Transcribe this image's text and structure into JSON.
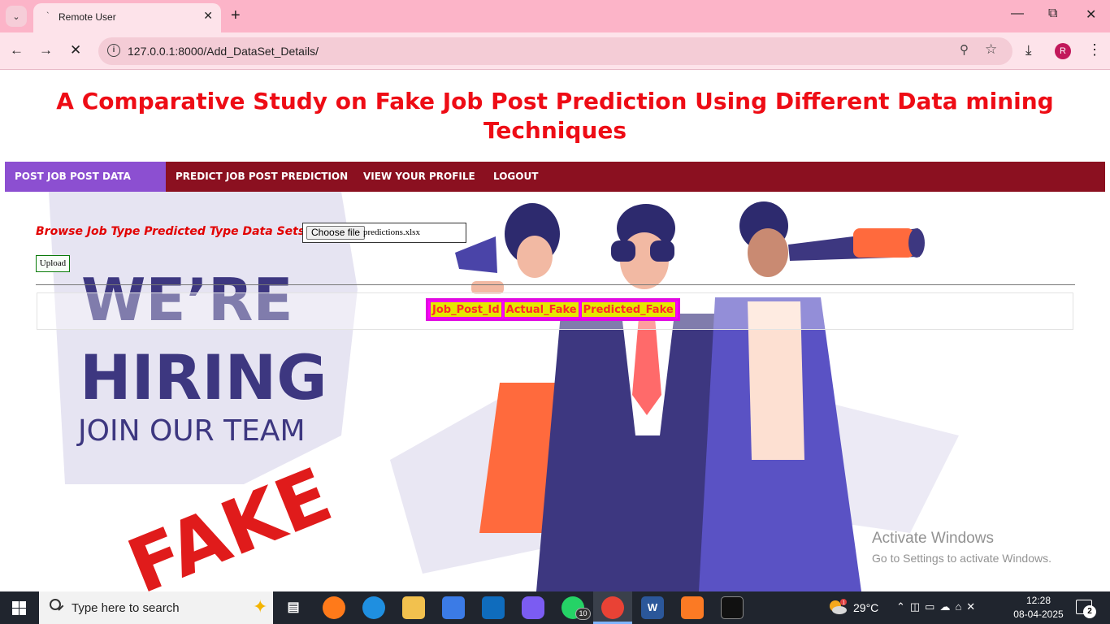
{
  "browser": {
    "tab_title": "Remote User",
    "tab_spinner": "`",
    "url": "127.0.0.1:8000/Add_DataSet_Details/",
    "profile_initial": "R"
  },
  "page": {
    "title": "A Comparative Study on Fake Job Post Prediction Using Different Data mining Techniques",
    "nav": [
      {
        "label": "POST JOB POST DATA SETS",
        "active": true
      },
      {
        "label": "PREDICT JOB POST PREDICTION",
        "active": false
      },
      {
        "label": "VIEW YOUR PROFILE",
        "active": false
      },
      {
        "label": "LOGOUT",
        "active": false
      }
    ],
    "browse_label": "Browse Job Type Predicted Type Data Sets",
    "choose_file_label": "Choose file",
    "file_name": "predictions.xlsx",
    "upload_label": "Upload",
    "table_headers": [
      "Job_Post_Id",
      "Actual_Fake",
      "Predicted_Fake"
    ],
    "banner": {
      "line1": "WE’RE",
      "line2": "HIRING",
      "line3": "JOIN OUR TEAM",
      "stamp": "FAKE"
    }
  },
  "watermark": {
    "title": "Activate Windows",
    "subtitle": "Go to Settings to activate Windows."
  },
  "taskbar": {
    "search_placeholder": "Type here to search",
    "whatsapp_badge": "10",
    "weather_temp": "29°C",
    "weather_alert": "1",
    "time": "12:28",
    "date": "08-04-2025",
    "notification_count": "2",
    "word_label": "W",
    "icons": [
      "windows-start-icon",
      "task-view-icon",
      "firefox-icon",
      "edge-icon",
      "file-explorer-icon",
      "store-icon",
      "outlook-icon",
      "copilot-icon",
      "whatsapp-icon",
      "chrome-icon",
      "word-icon",
      "xampp-icon",
      "terminal-icon"
    ]
  },
  "colors": {
    "title_red": "#ee0c15",
    "navbar": "#8b1020",
    "nav_active": "#8c4fd1",
    "table_border": "#e10ae1",
    "table_cell": "#e6e600",
    "browser_tabbar": "#fcb4c8"
  }
}
